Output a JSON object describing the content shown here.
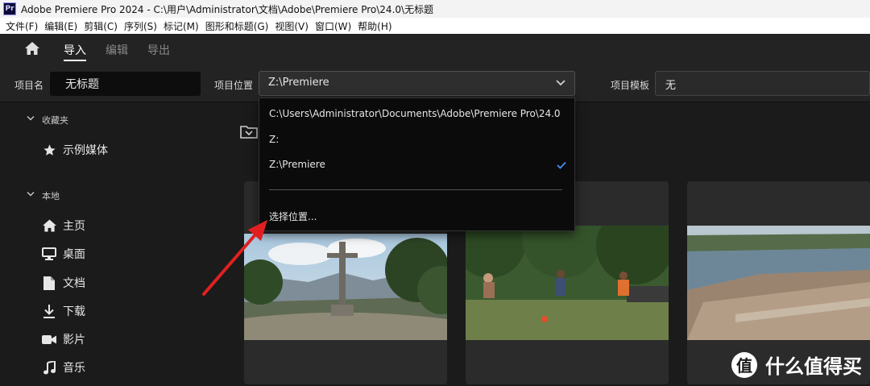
{
  "window": {
    "app_icon": "Pr",
    "title": "Adobe Premiere Pro 2024 - C:\\用户\\Administrator\\文档\\Adobe\\Premiere Pro\\24.0\\无标题"
  },
  "menubar": {
    "items": [
      "文件(F)",
      "编辑(E)",
      "剪辑(C)",
      "序列(S)",
      "标记(M)",
      "图形和标题(G)",
      "视图(V)",
      "窗口(W)",
      "帮助(H)"
    ]
  },
  "nav": {
    "home_icon": "home-icon",
    "tabs": [
      "导入",
      "编辑",
      "导出"
    ],
    "active_tab": 0
  },
  "project": {
    "name_label": "项目名",
    "name_value": "无标题",
    "location_label": "项目位置",
    "location_value": "Z:\\Premiere",
    "template_label": "项目模板",
    "template_value": "无"
  },
  "location_dropdown": {
    "options": [
      "C:\\Users\\Administrator\\Documents\\Adobe\\Premiere Pro\\24.0",
      "Z:",
      "Z:\\Premiere"
    ],
    "selected_index": 2,
    "choose_label": "选择位置..."
  },
  "sidebar": {
    "favorites_title": "收藏夹",
    "favorites": [
      {
        "label": "示例媒体",
        "icon": "star-icon"
      }
    ],
    "local_title": "本地",
    "local": [
      {
        "label": "主页",
        "icon": "home-icon"
      },
      {
        "label": "桌面",
        "icon": "monitor-icon"
      },
      {
        "label": "文档",
        "icon": "document-icon"
      },
      {
        "label": "下载",
        "icon": "download-icon"
      },
      {
        "label": "影片",
        "icon": "video-camera-icon"
      },
      {
        "label": "音乐",
        "icon": "music-note-icon"
      }
    ]
  },
  "watermark": {
    "badge": "值",
    "text": "什么值得买"
  },
  "colors": {
    "accent_check": "#4b8ef7",
    "annotation_arrow": "#e02020"
  }
}
